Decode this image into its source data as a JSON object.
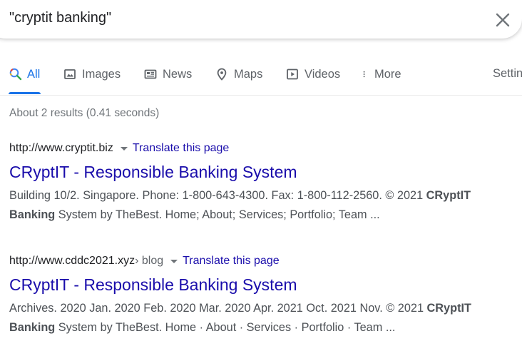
{
  "search": {
    "query": "\"cryptit banking\""
  },
  "tabs": [
    {
      "label": "All",
      "icon": "search-icon",
      "active": true
    },
    {
      "label": "Images",
      "icon": "image-icon",
      "active": false
    },
    {
      "label": "News",
      "icon": "news-icon",
      "active": false
    },
    {
      "label": "Maps",
      "icon": "map-pin-icon",
      "active": false
    },
    {
      "label": "Videos",
      "icon": "video-icon",
      "active": false
    },
    {
      "label": "More",
      "icon": "more-vert-icon",
      "active": false
    },
    {
      "label": "Settin",
      "icon": "",
      "active": false
    }
  ],
  "stats": "About 2 results (0.41 seconds)",
  "results": [
    {
      "url": "http://www.cryptit.biz",
      "path": "",
      "translate": "Translate this page",
      "title": "CRyptIT - Responsible Banking System",
      "snippet_pre": "Building 10/2. Singapore. Phone: 1-800-643-4300. Fax: 1-800-112-2560. © 2021 ",
      "snippet_bold1": "CRyptIT",
      "snippet_mid": " ",
      "snippet_bold2": "Banking",
      "snippet_post": " System by TheBest. Home; About; Services; Portfolio; Team ..."
    },
    {
      "url": "http://www.cddc2021.xyz",
      "path": " › blog",
      "translate": "Translate this page",
      "title": "CRyptIT - Responsible Banking System",
      "snippet_pre": "Archives. 2020 Jan. 2020 Feb. 2020 Mar. 2020 Apr. 2021 Oct. 2021 Nov. © 2021 ",
      "snippet_bold1": "CRyptIT",
      "snippet_mid": " ",
      "snippet_bold2": "Banking",
      "snippet_post": " System by TheBest. Home · About · Services · Portfolio · Team ..."
    }
  ],
  "colors": {
    "link": "#1a0dab",
    "accent": "#1a73e8",
    "muted": "#5f6368",
    "snippet": "#4d5156"
  }
}
